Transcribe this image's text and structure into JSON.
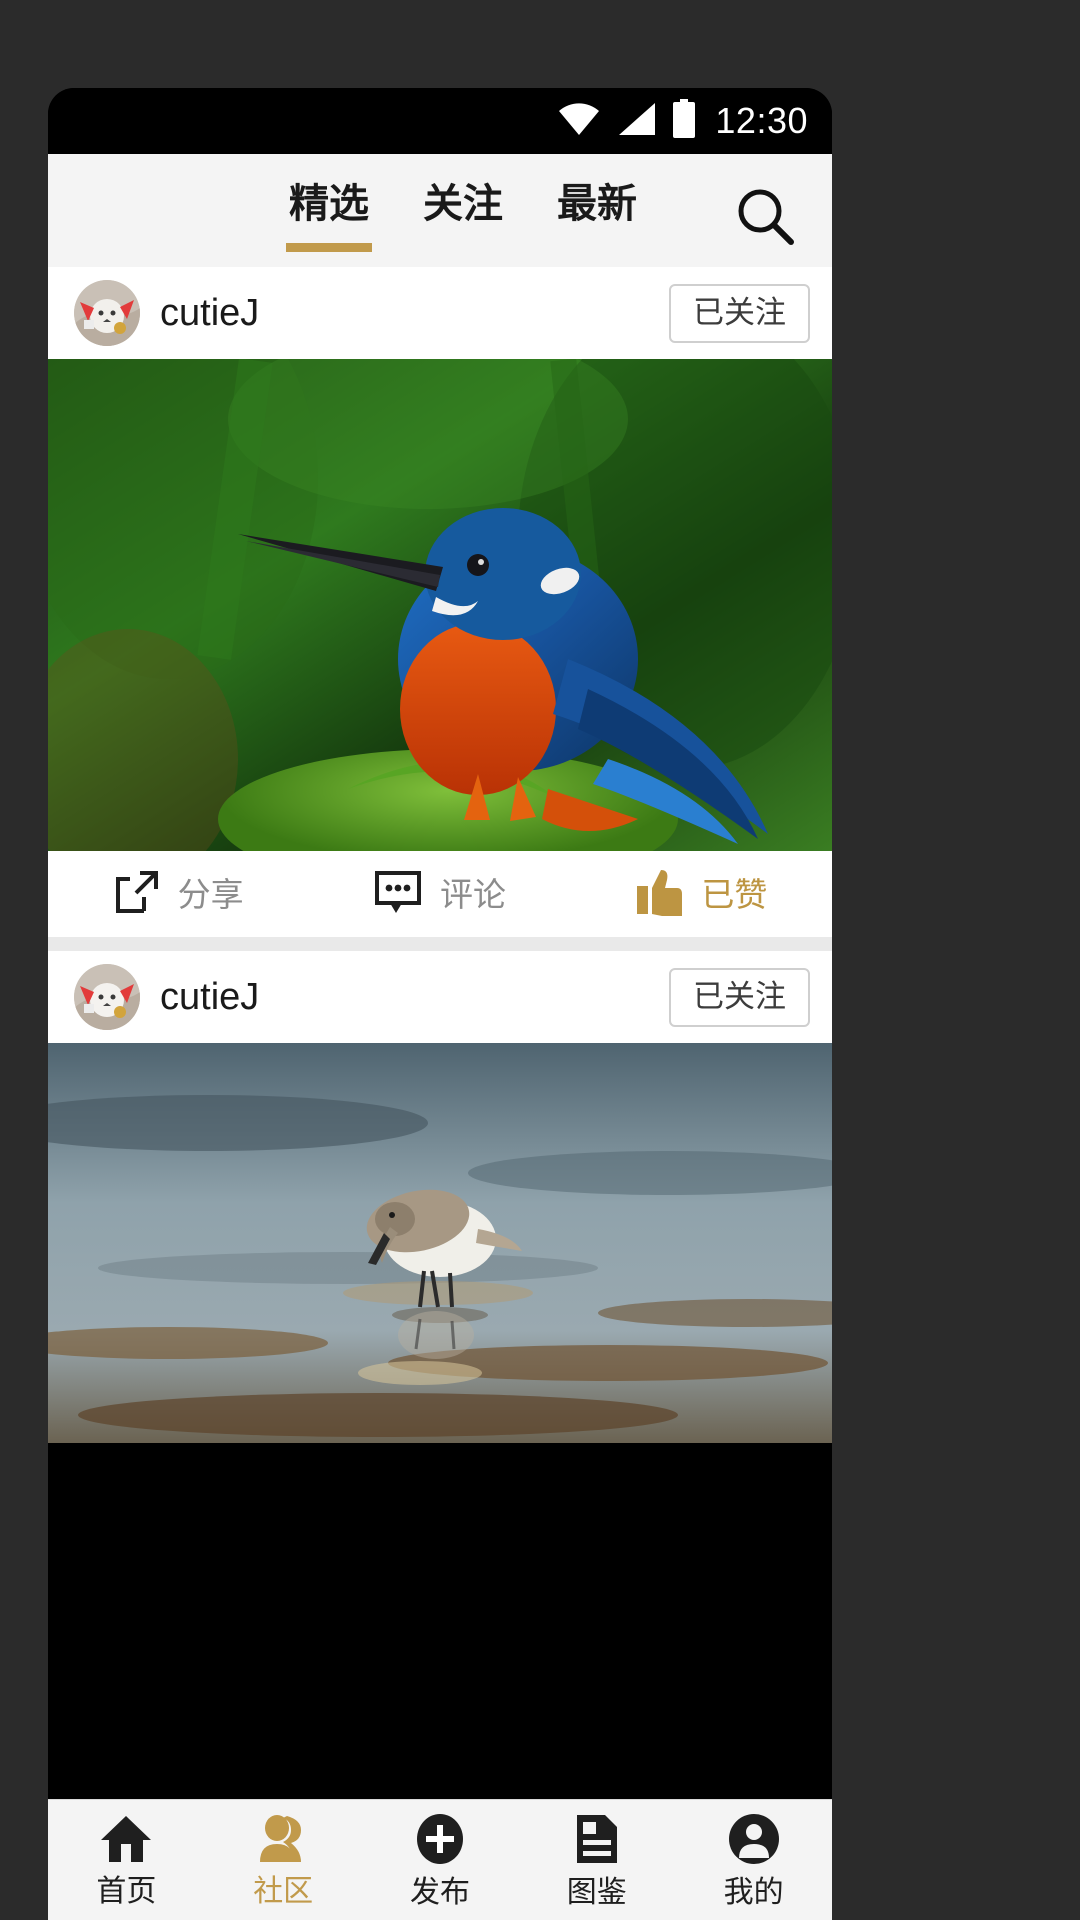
{
  "status_bar": {
    "time": "12:30",
    "icons": [
      "wifi-icon",
      "cellular-signal-icon",
      "battery-icon"
    ]
  },
  "top_tabs": {
    "items": [
      {
        "label": "精选",
        "active": true
      },
      {
        "label": "关注",
        "active": false
      },
      {
        "label": "最新",
        "active": false
      }
    ],
    "search_icon": "search-icon",
    "active_indicator_color": "#c19a4b"
  },
  "feed": {
    "posts": [
      {
        "username": "cutieJ",
        "avatar": "dog-avatar",
        "follow_label": "已关注",
        "image": "kingfisher-bird-photo",
        "actions": [
          {
            "label": "分享",
            "icon": "share-icon",
            "active": false
          },
          {
            "label": "评论",
            "icon": "comment-icon",
            "active": false
          },
          {
            "label": "已赞",
            "icon": "thumbs-up-icon",
            "active": true
          }
        ]
      },
      {
        "username": "cutieJ",
        "avatar": "dog-avatar",
        "follow_label": "已关注",
        "image": "sandpiper-shorebird-photo"
      }
    ]
  },
  "bottom_nav": {
    "items": [
      {
        "label": "首页",
        "icon": "home-icon",
        "active": false
      },
      {
        "label": "社区",
        "icon": "people-icon",
        "active": true
      },
      {
        "label": "发布",
        "icon": "plus-circle-icon",
        "active": false
      },
      {
        "label": "图鉴",
        "icon": "document-icon",
        "active": false
      },
      {
        "label": "我的",
        "icon": "person-icon",
        "active": false
      }
    ],
    "active_color": "#c19a4b"
  }
}
